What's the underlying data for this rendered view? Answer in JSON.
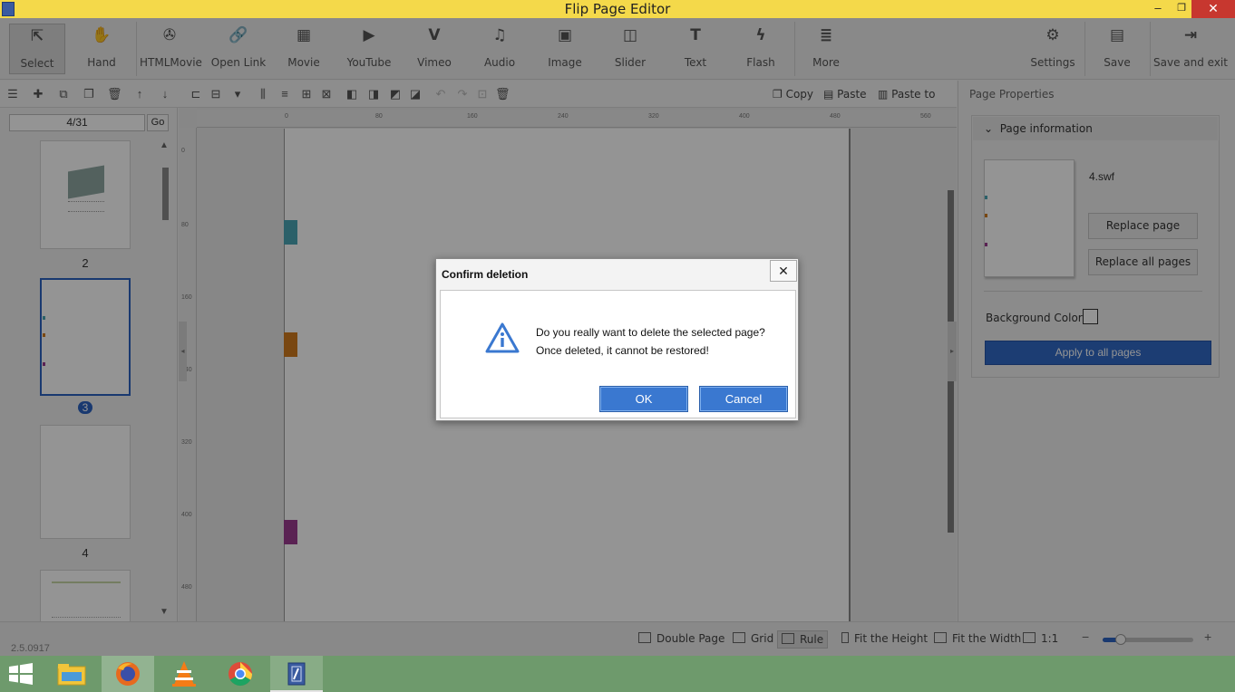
{
  "window": {
    "title": "Flip Page Editor",
    "min_glyph": "–",
    "max_glyph": "❐",
    "close_glyph": "✕"
  },
  "toolbar": {
    "items": [
      {
        "label": "Select",
        "icon": "cursor-select-icon",
        "glyph": "⇱"
      },
      {
        "label": "Hand",
        "icon": "hand-icon",
        "glyph": "✋"
      },
      {
        "label": "HTMLMovie",
        "icon": "film-reel-icon",
        "glyph": "✇"
      },
      {
        "label": "Open Link",
        "icon": "link-icon",
        "glyph": "🔗"
      },
      {
        "label": "Movie",
        "icon": "film-strip-icon",
        "glyph": "▦"
      },
      {
        "label": "YouTube",
        "icon": "youtube-icon",
        "glyph": "▶"
      },
      {
        "label": "Vimeo",
        "icon": "vimeo-icon",
        "glyph": "V"
      },
      {
        "label": "Audio",
        "icon": "music-note-icon",
        "glyph": "♫"
      },
      {
        "label": "Image",
        "icon": "image-icon",
        "glyph": "▣"
      },
      {
        "label": "Slider",
        "icon": "slider-icon",
        "glyph": "◫"
      },
      {
        "label": "Text",
        "icon": "text-icon",
        "glyph": "T"
      },
      {
        "label": "Flash",
        "icon": "flash-icon",
        "glyph": "ϟ"
      },
      {
        "label": "More",
        "icon": "more-icon",
        "glyph": "≣"
      }
    ],
    "right_items": [
      {
        "label": "Settings",
        "icon": "gear-icon",
        "glyph": "⚙"
      },
      {
        "label": "Save",
        "icon": "save-icon",
        "glyph": "▤"
      },
      {
        "label": "Save and exit",
        "icon": "save-exit-icon",
        "glyph": "⇥"
      }
    ]
  },
  "edit_toolbar": {
    "copy_label": "Copy",
    "paste_label": "Paste",
    "paste_to_label": "Paste to"
  },
  "pages_panel": {
    "page_indicator": "4/31",
    "go_label": "Go",
    "thumbnails": [
      {
        "label": "2"
      },
      {
        "label": "3",
        "selected": true
      },
      {
        "label": "4"
      }
    ]
  },
  "rulers": {
    "top": [
      "0",
      "80",
      "160",
      "240",
      "320",
      "400",
      "480",
      "560"
    ],
    "left": [
      "0",
      "80",
      "160",
      "240",
      "320",
      "400",
      "480"
    ]
  },
  "canvas": {
    "tab_colors": [
      "#4aa6b5",
      "#d07a1e",
      "#9b3c8f"
    ]
  },
  "properties_panel": {
    "title": "Page Properties",
    "section": "Page information",
    "file_name": "4.swf",
    "replace_page_label": "Replace page",
    "replace_all_label": "Replace all pages",
    "background_color_label": "Background Color",
    "apply_all_label": "Apply to all pages"
  },
  "statusbar": {
    "version": "2.5.0917",
    "double_page": "Double Page",
    "grid": "Grid",
    "rule": "Rule",
    "fit_height": "Fit the Height",
    "fit_width": "Fit the Width",
    "actual_size": "1:1",
    "zoom_level": 0.2
  },
  "dialog": {
    "title": "Confirm deletion",
    "message": "Do you really want to delete the selected page? Once deleted, it cannot be restored!",
    "ok_label": "OK",
    "cancel_label": "Cancel",
    "icon": "info-icon"
  },
  "taskbar": {
    "apps": [
      {
        "name": "windows-start-icon"
      },
      {
        "name": "file-explorer-icon"
      },
      {
        "name": "firefox-icon"
      },
      {
        "name": "vlc-icon"
      },
      {
        "name": "chrome-icon"
      },
      {
        "name": "flip-page-editor-icon"
      }
    ]
  },
  "colors": {
    "accent": "#2c62c2",
    "titlebar": "#f4d94a",
    "taskbar": "#6e9a6c"
  }
}
